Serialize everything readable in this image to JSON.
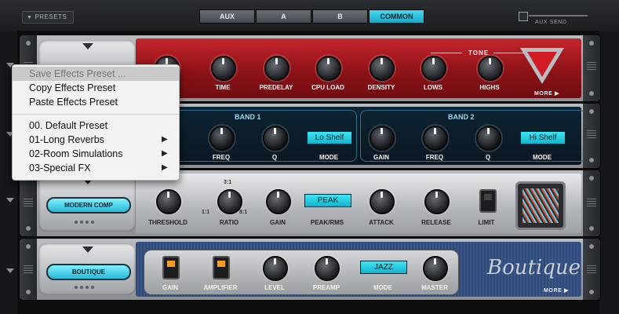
{
  "topbar": {
    "presets_label": "PRESETS",
    "tabs": [
      "AUX",
      "A",
      "B",
      "COMMON"
    ],
    "active_tab": "COMMON",
    "aux_send_label": "AUX SEND"
  },
  "reverb": {
    "tone_label": "TONE",
    "knobs": [
      "TIME",
      "PREDELAY",
      "CPU LOAD",
      "DENSITY",
      "LOWS",
      "HIGHS"
    ],
    "more_label": "MORE ▶"
  },
  "eq": {
    "band1": {
      "title": "BAND 1",
      "mode_value": "Lo Shelf",
      "knobs": [
        "FREQ",
        "Q",
        "MODE"
      ]
    },
    "band2": {
      "title": "BAND 2",
      "mode_value": "Hi Shelf",
      "knobs": [
        "GAIN",
        "FREQ",
        "Q",
        "MODE"
      ]
    }
  },
  "comp": {
    "name": "MODERN COMP",
    "knobs": [
      "THRESHOLD",
      "RATIO",
      "GAIN",
      "PEAK/RMS",
      "ATTACK",
      "RELEASE",
      "LIMIT"
    ],
    "mode_value": "PEAK",
    "ratio_ticks": [
      "3:1",
      "1:1",
      "8:1"
    ]
  },
  "boutique": {
    "name": "BOUTIQUE",
    "knobs": [
      "GAIN",
      "AMPLIFIER",
      "LEVEL",
      "PREAMP",
      "MODE",
      "MASTER"
    ],
    "mode_value": "JAZZ",
    "logo_text": "Boutique",
    "more_label": "MORE ▶"
  },
  "context_menu": {
    "items": [
      {
        "label": "Save Effects Preset ...",
        "highlighted": true
      },
      {
        "label": "Copy Effects Preset"
      },
      {
        "label": "Paste Effects Preset"
      },
      {
        "label": "00. Default Preset"
      },
      {
        "label": "01-Long Reverbs",
        "submenu": true
      },
      {
        "label": "02-Room Simulations",
        "submenu": true
      },
      {
        "label": "03-Special FX",
        "submenu": true
      }
    ]
  },
  "colors": {
    "accent_cyan": "#29b8d6",
    "reverb_red": "#a0161c",
    "eq_navy": "#0e2433",
    "boutique_blue": "#324f80"
  }
}
